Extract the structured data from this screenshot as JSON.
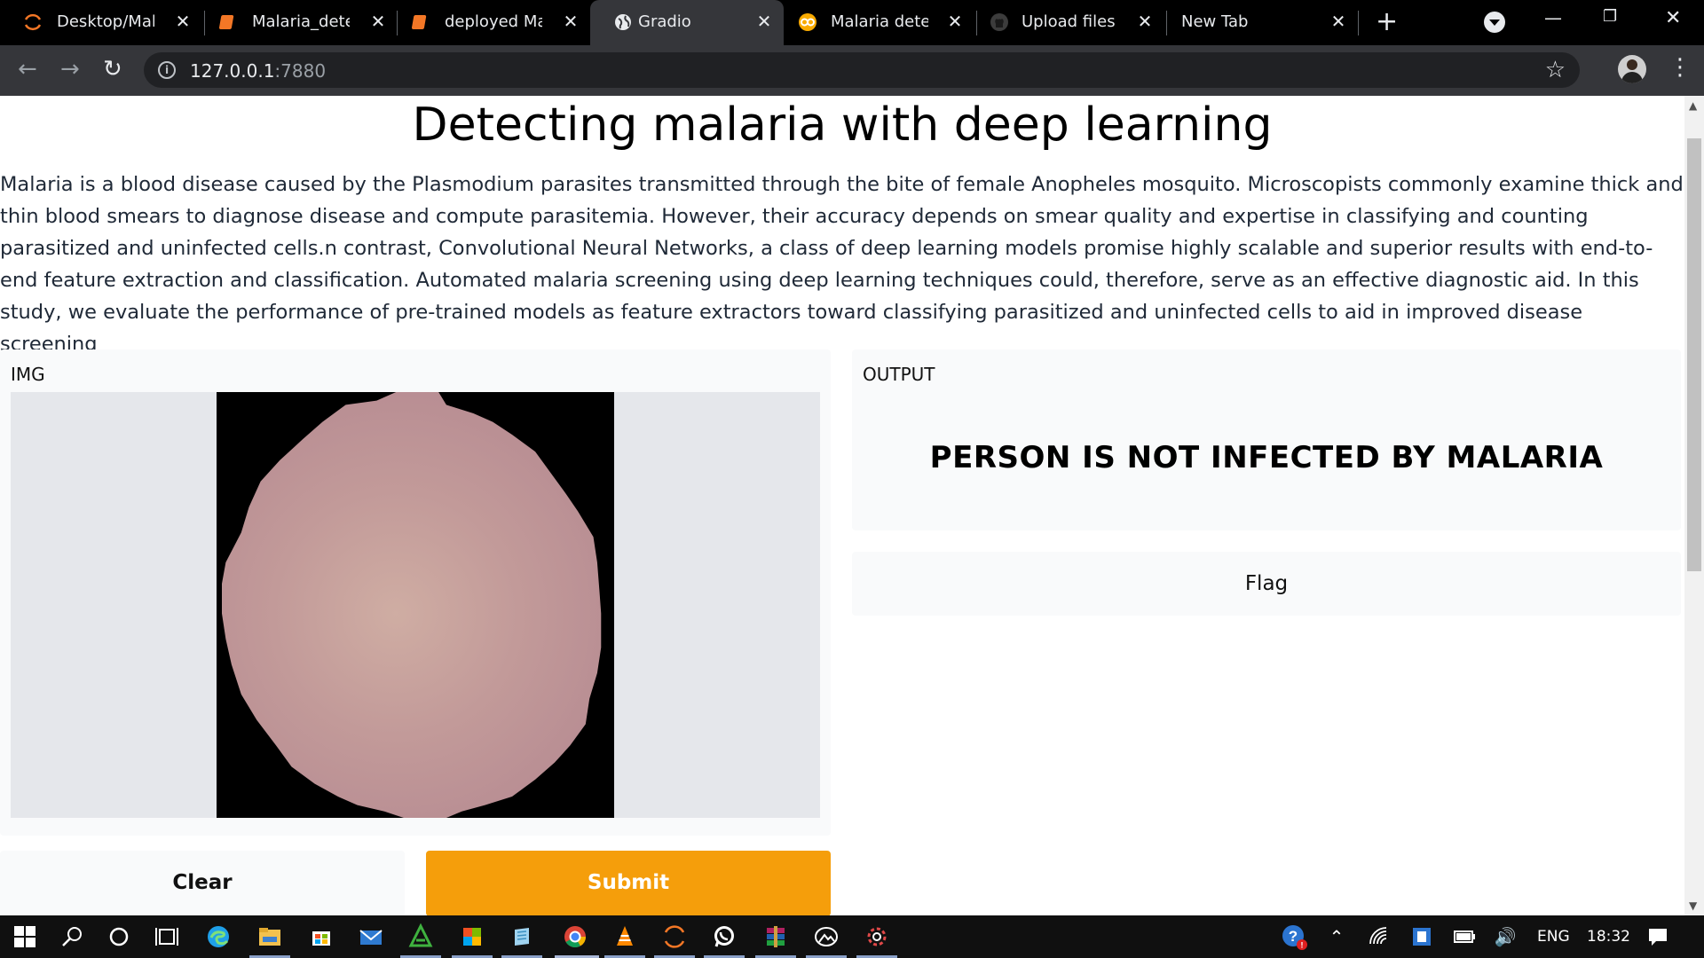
{
  "browser": {
    "tabs": [
      {
        "title": "Desktop/Malaria",
        "icon": "jupyter-icon"
      },
      {
        "title": "Malaria_detection",
        "icon": "notebook-icon"
      },
      {
        "title": "deployed Malaria",
        "icon": "notebook-icon"
      },
      {
        "title": "Gradio",
        "icon": "globe-icon",
        "active": true
      },
      {
        "title": "Malaria detection",
        "icon": "colab-icon"
      },
      {
        "title": "Upload files · s",
        "icon": "github-icon"
      },
      {
        "title": "New Tab",
        "icon": ""
      }
    ],
    "url_host": "127.0.0.1",
    "url_port": ":7880"
  },
  "page": {
    "title": "Detecting malaria with deep learning",
    "description": "Malaria is a blood disease caused by the Plasmodium parasites transmitted through the bite of female Anopheles mosquito. Microscopists commonly examine thick and thin blood smears to diagnose disease and compute parasitemia. However, their accuracy depends on smear quality and expertise in classifying and counting parasitized and uninfected cells.n contrast, Convolutional Neural Networks, a class of deep learning models promise highly scalable and superior results with end-to-end feature extraction and classification. Automated malaria screening using deep learning techniques could, therefore, serve as an effective diagnostic aid. In this study, we evaluate the performance of pre-trained models as feature extractors toward classifying parasitized and uninfected cells to aid in improved disease screening",
    "input_label": "IMG",
    "output_label": "OUTPUT",
    "output_text": "PERSON IS NOT INFECTED BY MALARIA",
    "flag_label": "Flag",
    "clear_label": "Clear",
    "submit_label": "Submit",
    "accent_color": "#f59e0b"
  },
  "taskbar": {
    "language": "ENG",
    "time": "18:32"
  }
}
